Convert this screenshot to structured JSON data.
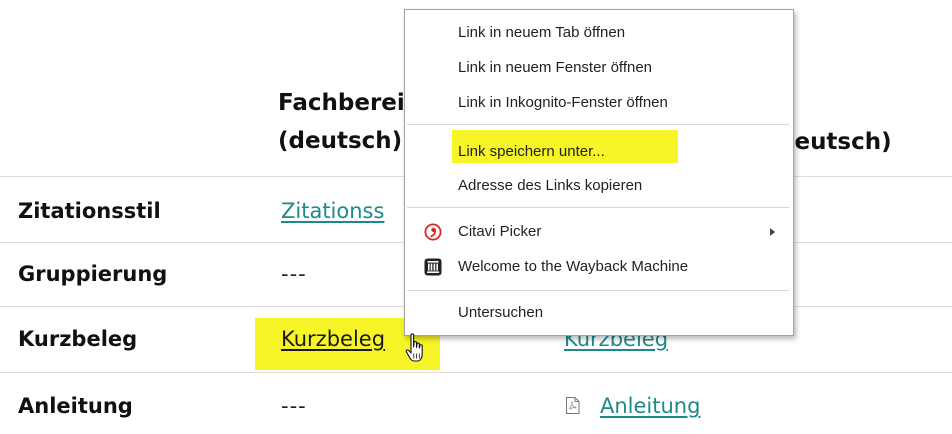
{
  "table": {
    "headers": {
      "col1_line1": "Fachberei",
      "col1_line2": "(deutsch)",
      "col2_tail": "deutsch)"
    },
    "rows": [
      {
        "label": "Zitationsstil",
        "col1": "Zitationss",
        "col2": ""
      },
      {
        "label": "Gruppierung",
        "col1": "---",
        "col2": ""
      },
      {
        "label": "Kurzbeleg",
        "col1": "Kurzbeleg",
        "col2": "Kurzbeleg"
      },
      {
        "label": "Anleitung",
        "col1": "---",
        "col2": "Anleitung"
      }
    ],
    "link_color": "#1d8a8a",
    "highlight_color": "#f7f528"
  },
  "context_menu": {
    "groups": [
      [
        {
          "label": "Link in neuem Tab öffnen"
        },
        {
          "label": "Link in neuem Fenster öffnen"
        },
        {
          "label": "Link in Inkognito-Fenster öffnen"
        }
      ],
      [
        {
          "label": "Link speichern unter...",
          "highlighted": true
        },
        {
          "label": "Adresse des Links kopieren"
        }
      ],
      [
        {
          "label": "Citavi Picker",
          "icon": "citavi-icon",
          "submenu": true
        },
        {
          "label": "Welcome to the Wayback Machine",
          "icon": "wayback-machine-icon"
        }
      ],
      [
        {
          "label": "Untersuchen"
        }
      ]
    ]
  }
}
